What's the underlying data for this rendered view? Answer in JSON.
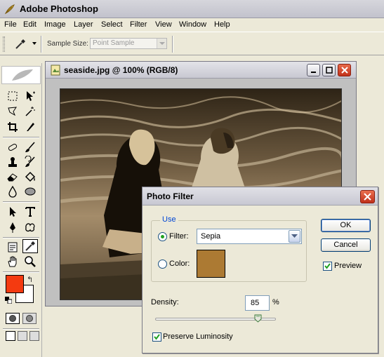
{
  "app": {
    "title": "Adobe Photoshop"
  },
  "menu": [
    "File",
    "Edit",
    "Image",
    "Layer",
    "Select",
    "Filter",
    "View",
    "Window",
    "Help"
  ],
  "options": {
    "sample_size_label": "Sample Size:",
    "sample_size_value": "Point Sample"
  },
  "document": {
    "title": "seaside.jpg @ 100% (RGB/8)"
  },
  "colors": {
    "foreground": "#f43a10",
    "background": "#ffffff",
    "filter_color": "#ac7a33"
  },
  "dialog": {
    "title": "Photo Filter",
    "use_legend": "Use",
    "filter_label": "Filter:",
    "filter_value": "Sepia",
    "color_label": "Color:",
    "density_label": "Density:",
    "density_value": "85",
    "density_unit": "%",
    "density_percent": 85,
    "preserve_label": "Preserve Luminosity",
    "ok_label": "OK",
    "cancel_label": "Cancel",
    "preview_label": "Preview",
    "preview_checked": true,
    "preserve_checked": true,
    "use_mode": "filter"
  },
  "tools": [
    "marquee-tool",
    "move-tool",
    "lasso-tool",
    "magic-wand-tool",
    "crop-tool",
    "slice-tool",
    "healing-brush-tool",
    "brush-tool",
    "clone-stamp-tool",
    "history-brush-tool",
    "eraser-tool",
    "paint-bucket-tool",
    "blur-tool",
    "dodge-tool",
    "path-selection-tool",
    "type-tool",
    "pen-tool",
    "custom-shape-tool",
    "notes-tool",
    "eyedropper-tool",
    "hand-tool",
    "zoom-tool"
  ]
}
